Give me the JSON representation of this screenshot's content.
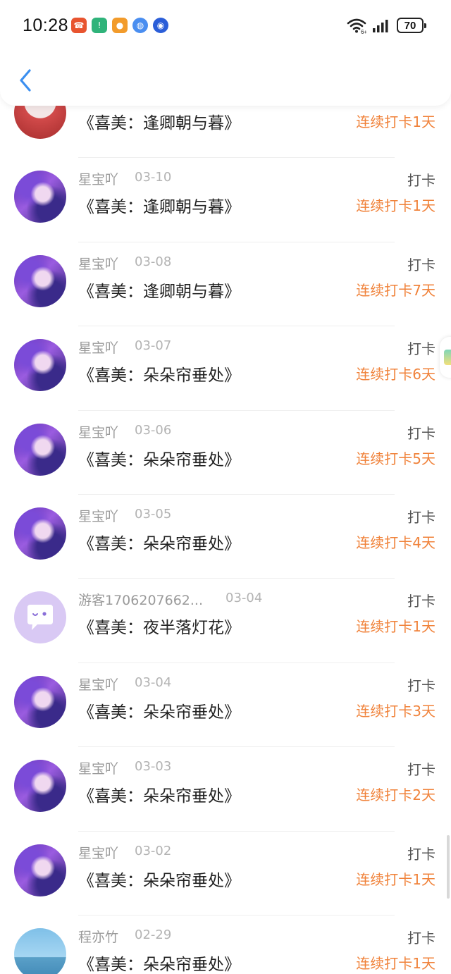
{
  "status_bar": {
    "time": "10:28",
    "battery": "70",
    "app_icons": [
      {
        "name": "phone-app-icon",
        "color": "#e8542f",
        "glyph": "☎"
      },
      {
        "name": "shield-app-icon",
        "color": "#2fb37a",
        "glyph": "!"
      },
      {
        "name": "weibo-app-icon",
        "color": "#f29b2b",
        "glyph": "●"
      },
      {
        "name": "globe-app-icon",
        "color": "#4a8ef0",
        "glyph": "◍"
      },
      {
        "name": "target-app-icon",
        "color": "#2b5ed8",
        "glyph": "◉"
      }
    ]
  },
  "header": {
    "back_icon": "chevron-left-icon"
  },
  "colors": {
    "accent_orange": "#f0823a",
    "back_blue": "#3b8ff0"
  },
  "rows": [
    {
      "avatar": "top",
      "name": "",
      "date": "",
      "title": "《喜美：逢卿朝与暮》",
      "action": "",
      "streak": "连续打卡1天"
    },
    {
      "avatar": "star",
      "name": "星宝吖",
      "date": "03-10",
      "title": "《喜美：逢卿朝与暮》",
      "action": "打卡",
      "streak": "连续打卡1天"
    },
    {
      "avatar": "star",
      "name": "星宝吖",
      "date": "03-08",
      "title": "《喜美：逢卿朝与暮》",
      "action": "打卡",
      "streak": "连续打卡7天"
    },
    {
      "avatar": "star",
      "name": "星宝吖",
      "date": "03-07",
      "title": "《喜美：朵朵帘垂处》",
      "action": "打卡",
      "streak": "连续打卡6天"
    },
    {
      "avatar": "star",
      "name": "星宝吖",
      "date": "03-06",
      "title": "《喜美：朵朵帘垂处》",
      "action": "打卡",
      "streak": "连续打卡5天"
    },
    {
      "avatar": "star",
      "name": "星宝吖",
      "date": "03-05",
      "title": "《喜美：朵朵帘垂处》",
      "action": "打卡",
      "streak": "连续打卡4天"
    },
    {
      "avatar": "guest",
      "name": "游客1706207662...",
      "date": "03-04",
      "title": "《喜美：夜半落灯花》",
      "action": "打卡",
      "streak": "连续打卡1天"
    },
    {
      "avatar": "star",
      "name": "星宝吖",
      "date": "03-04",
      "title": "《喜美：朵朵帘垂处》",
      "action": "打卡",
      "streak": "连续打卡3天"
    },
    {
      "avatar": "star",
      "name": "星宝吖",
      "date": "03-03",
      "title": "《喜美：朵朵帘垂处》",
      "action": "打卡",
      "streak": "连续打卡2天"
    },
    {
      "avatar": "star",
      "name": "星宝吖",
      "date": "03-02",
      "title": "《喜美：朵朵帘垂处》",
      "action": "打卡",
      "streak": "连续打卡1天"
    },
    {
      "avatar": "cheng",
      "name": "程亦竹",
      "date": "02-29",
      "title": "《喜美：朵朵帘垂处》",
      "action": "打卡",
      "streak": "连续打卡1天"
    }
  ]
}
